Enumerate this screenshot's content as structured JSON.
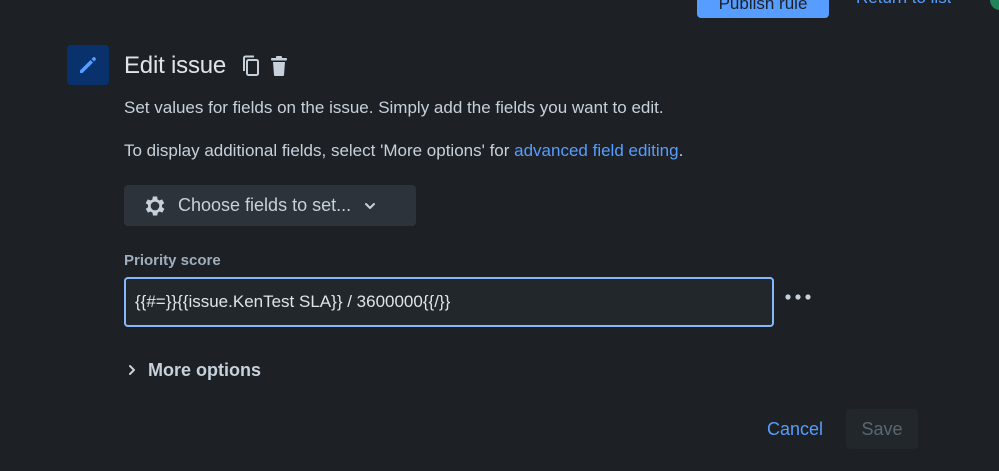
{
  "header": {
    "publish_label": "Publish rule",
    "return_label": "Return to list"
  },
  "action": {
    "icon": "pencil-icon",
    "title": "Edit issue",
    "copy_icon": "copy-icon",
    "delete_icon": "trash-icon"
  },
  "description": {
    "line1": "Set values for fields on the issue. Simply add the fields you want to edit.",
    "line2_prefix": "To display additional fields, select 'More options' for ",
    "line2_link": "advanced field editing",
    "line2_suffix": "."
  },
  "choose_fields": {
    "label": "Choose fields to set...",
    "icon": "gear-icon",
    "chevron": "chevron-down-icon"
  },
  "field": {
    "label": "Priority score",
    "value": "{{#=}}{{issue.KenTest SLA}} / 3600000{{/}}",
    "more_icon": "more-horizontal-icon"
  },
  "more_options": {
    "label": "More options",
    "icon": "chevron-right-icon"
  },
  "footer": {
    "cancel_label": "Cancel",
    "save_label": "Save"
  },
  "colors": {
    "background": "#1d2125",
    "accent": "#579dff",
    "focus_border": "#85b8ff",
    "tile": "#09326c"
  }
}
